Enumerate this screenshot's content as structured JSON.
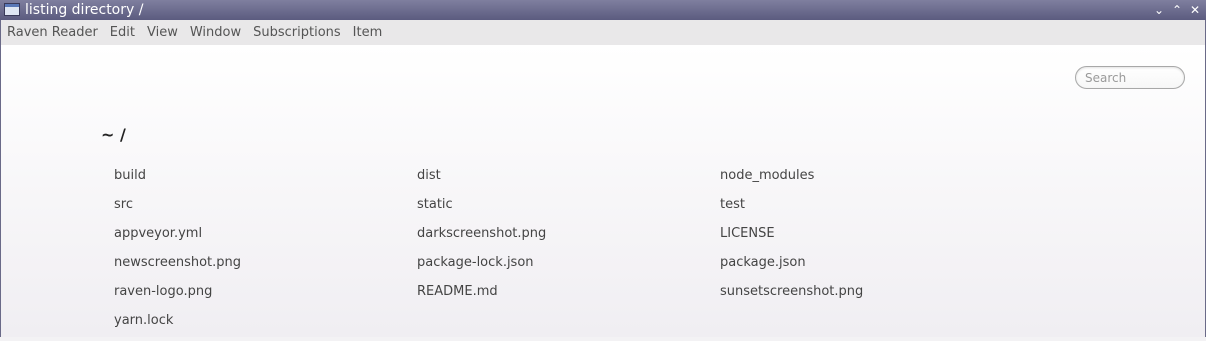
{
  "window": {
    "title": "listing directory /",
    "controls": {
      "minimize": "⌄",
      "maximize": "⌃",
      "close": "✕"
    }
  },
  "menubar": {
    "items": [
      "Raven Reader",
      "Edit",
      "View",
      "Window",
      "Subscriptions",
      "Item"
    ]
  },
  "search": {
    "placeholder": "Search",
    "value": ""
  },
  "listing": {
    "heading": "~ /",
    "files": [
      "build",
      "dist",
      "node_modules",
      "src",
      "static",
      "test",
      "appveyor.yml",
      "darkscreenshot.png",
      "LICENSE",
      "newscreenshot.png",
      "package-lock.json",
      "package.json",
      "raven-logo.png",
      "README.md",
      "sunsetscreenshot.png",
      "yarn.lock"
    ]
  },
  "colors": {
    "titlebar_top": "#7f7f9f",
    "titlebar_bottom": "#5b5b7f",
    "menubar_bg": "#e9e8e9",
    "text": "#444444"
  }
}
